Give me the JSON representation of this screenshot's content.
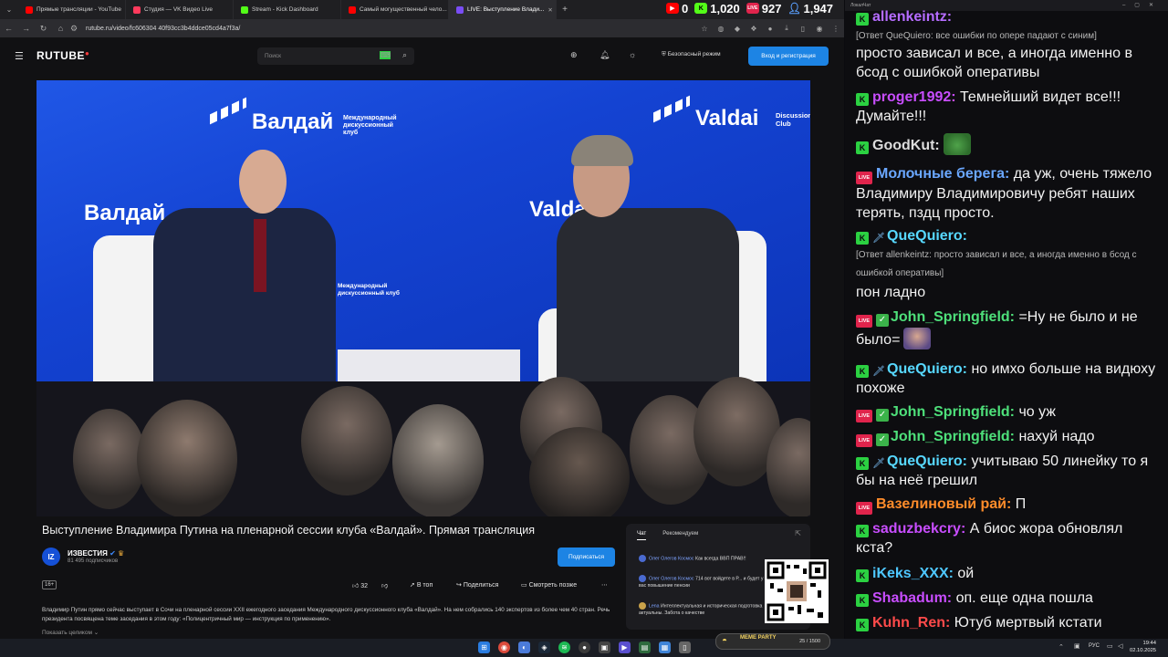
{
  "browser": {
    "tabs": [
      {
        "label": "Прямые трансляции - YouTube",
        "color": "#ff0000"
      },
      {
        "label": "Студия — VK Видео Live",
        "color": "#ff3a5c"
      },
      {
        "label": "Stream - Kick Dashboard",
        "color": "#53fc18"
      },
      {
        "label": "Самый могущественный чело...",
        "color": "#ff0000"
      },
      {
        "label": "LIVE: Выступление Влади...",
        "color": "#7a4df5",
        "active": true
      }
    ],
    "url": "rutube.ru/video/fc606304 40f93cc3b4ddce05cd4a7f3a/"
  },
  "stream_stats": {
    "youtube": "0",
    "kick": "1,020",
    "vk": "927",
    "viewers": "1,947"
  },
  "rutube": {
    "logo": "RUTUBE",
    "search_placeholder": "Поиск",
    "safe_mode": "Безопасный режим",
    "login": "Вход и регистрация"
  },
  "video": {
    "banner_ru": "Валдай",
    "banner_sub": "Международный дискуссионный клуб",
    "banner_en": "Valdai",
    "banner_en_sub": "Discussion Club",
    "title": "Выступление Владимира Путина на пленарной сессии клуба «Валдай». Прямая трансляция",
    "channel": {
      "name": "ИЗВЕСТИЯ",
      "subs": "81 495 подписчиков",
      "avatar_text": "IZ"
    },
    "subscribe": "Подписаться",
    "age": "16+",
    "likes": "32",
    "actions": [
      "В топ",
      "Поделиться",
      "Смотреть позже"
    ],
    "description": "Владимир Путин прямо сейчас выступает в Сочи на пленарной сессии XXII ежегодного заседания Международного дискуссионного клуба «Валдай». На нем собрались 140 экспертов из более чем 40 стран. Речь президента посвящена теме заседания в этом году: «Полицентричный мир — инструкция по применению».",
    "show_more": "Показать целиком"
  },
  "video_chat": {
    "tabs": [
      "Чат",
      "Рекомендуем"
    ],
    "messages": [
      {
        "user": "Олег Олегов Космос",
        "text": "Как всегда ВВП ПРАВ!!"
      },
      {
        "user": "Олег Олегов Космос",
        "text": "714 вот войдете в Р... и будет у вас повышение пенсии"
      },
      {
        "user": "Lena",
        "text": "Интеллектуальная и историческая подготовка актуальны. Забота о качестве"
      }
    ]
  },
  "overlay": {
    "meme_party": "MEME PARTY",
    "meme_count": "25 / 1500"
  },
  "chat": {
    "window_title": "ЛокалЧат",
    "items": [
      {
        "type": "msg",
        "badges": [
          "kick"
        ],
        "user": "allenkeintz:",
        "color": "#b56cff",
        "text": ""
      },
      {
        "type": "reply",
        "text": "[Ответ QueQuiero: все ошибки по опере падают с синим]"
      },
      {
        "type": "text",
        "text": "просто зависал и все, а иногда именно в бсод с ошибкой оперативы"
      },
      {
        "type": "msg",
        "badges": [
          "kick"
        ],
        "user": "proger1992:",
        "color": "#c84dff",
        "text": "Темнейший видет все!!! Думайте!!!"
      },
      {
        "type": "msg",
        "badges": [
          "kick"
        ],
        "user": "GoodKut:",
        "color": "#dcdcdc",
        "text": ""
      },
      {
        "type": "msg",
        "badges": [
          "live"
        ],
        "user": "Молочные берега:",
        "color": "#6aa7ff",
        "text": "да уж, очень тяжело Владимиру Владимировичу ребят наших терять, пздц просто."
      },
      {
        "type": "msg",
        "badges": [
          "kick",
          "sword"
        ],
        "user": "QueQuiero:",
        "color": "#57d8ff",
        "text": ""
      },
      {
        "type": "reply",
        "text": "[Ответ allenkeintz: просто зависал и все, а иногда именно в бсод с ошибкой оперативы]"
      },
      {
        "type": "text",
        "text": "пон ладно"
      },
      {
        "type": "msg",
        "badges": [
          "live",
          "check"
        ],
        "user": "John_Springfield:",
        "color": "#4ee07a",
        "text": "=Ну не было и не было="
      },
      {
        "type": "msg",
        "badges": [
          "kick",
          "sword"
        ],
        "user": "QueQuiero:",
        "color": "#57d8ff",
        "text": "но имхо больше на видюху похоже"
      },
      {
        "type": "msg",
        "badges": [
          "live",
          "check"
        ],
        "user": "John_Springfield:",
        "color": "#4ee07a",
        "text": "чо уж"
      },
      {
        "type": "msg",
        "badges": [
          "live",
          "check"
        ],
        "user": "John_Springfield:",
        "color": "#4ee07a",
        "text": "нахуй надо"
      },
      {
        "type": "msg",
        "badges": [
          "kick",
          "sword"
        ],
        "user": "QueQuiero:",
        "color": "#57d8ff",
        "text": "учитываю 50 линейку то я бы на неё грешил"
      },
      {
        "type": "msg",
        "badges": [
          "live"
        ],
        "user": "Вазелиновый рай:",
        "color": "#ff8c2a",
        "text": "П"
      },
      {
        "type": "msg",
        "badges": [
          "kick"
        ],
        "user": "saduzbekcry:",
        "color": "#c84dff",
        "text": "А биос жора обновлял кста?"
      },
      {
        "type": "msg",
        "badges": [
          "kick"
        ],
        "user": "iKeks_XXX:",
        "color": "#4ec7ff",
        "text": "ой"
      },
      {
        "type": "msg",
        "badges": [
          "kick"
        ],
        "user": "Shabadum:",
        "color": "#c84dff",
        "text": "оп. еще одна пошла"
      },
      {
        "type": "msg",
        "badges": [
          "kick"
        ],
        "user": "Kuhn_Ren:",
        "color": "#ff4a4a",
        "text": "Ютуб мертвый кстати"
      }
    ]
  },
  "taskbar": {
    "lang": "РУС",
    "time": "19:44",
    "date": "02.10.2025"
  }
}
